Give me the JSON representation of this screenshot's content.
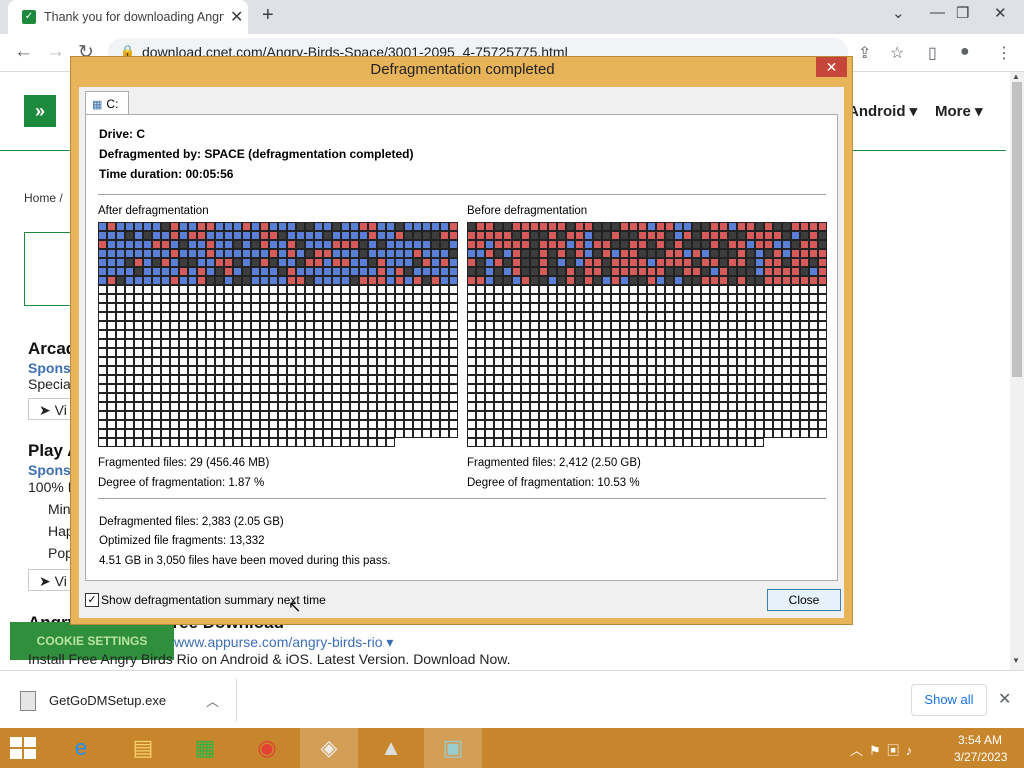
{
  "browser": {
    "tab_title": "Thank you for downloading Angry Birds Space",
    "new_tab": "+",
    "url": "download.cnet.com/Angry-Birds-Space/3001-2095_4-75725775.html"
  },
  "page": {
    "nav_android": "Android",
    "nav_more": "More",
    "breadcrumb_home": "Home",
    "breadcrumb_sep": "/",
    "heading1": "Arcad",
    "sponsored1": "Spons",
    "text1": "Specia",
    "btn1": "➤ Vi",
    "heading2": "Play A",
    "sponsored2": "Spons",
    "text2": "100% F",
    "list": [
      "Min",
      "Hap",
      "Pop"
    ],
    "btn2": "➤ Vi",
    "heading3": "Angry Birds Rio Free Download",
    "cookie_settings": "COOKIE SETTINGS",
    "appurse_link": "www.appurse.com/angry-birds-rio ▾",
    "install_text": "Install Free Angry Birds Rio on Android & iOS. Latest Version. Download Now."
  },
  "download_shelf": {
    "filename": "GetGoDMSetup.exe",
    "show_all": "Show all"
  },
  "dialog": {
    "title": "Defragmentation completed",
    "tab_label": "C:",
    "drive": "Drive: C",
    "defragmented_by": "Defragmented by: SPACE (defragmentation completed)",
    "duration": "Time duration: 00:05:56",
    "after_label": "After defragmentation",
    "before_label": "Before defragmentation",
    "after_fragmented_files": "Fragmented files: 29 (456.46 MB)",
    "after_degree": "Degree of fragmentation: 1.87 %",
    "before_fragmented_files": "Fragmented files: 2,412 (2.50 GB)",
    "before_degree": "Degree of fragmentation: 10.53 %",
    "defragmented_files": "Defragmented files: 2,383 (2.05 GB)",
    "optimized_fragments": "Optimized file fragments: 13,332",
    "moved_summary": "4.51 GB in 3,050 files have been moved during this pass.",
    "show_summary_checkbox": "Show defragmentation summary next time",
    "show_summary_checked": true,
    "close_button": "Close",
    "colors": {
      "blue": "#5b7fd6",
      "red": "#d65b5b",
      "dark": "#3d3d3d",
      "empty": "#ffffff"
    }
  },
  "taskbar": {
    "time": "3:54 AM",
    "date": "3/27/2023",
    "apps": [
      "internet-explorer",
      "file-explorer",
      "store",
      "chrome",
      "defrag-tool",
      "shark-game",
      "network-utility"
    ]
  }
}
